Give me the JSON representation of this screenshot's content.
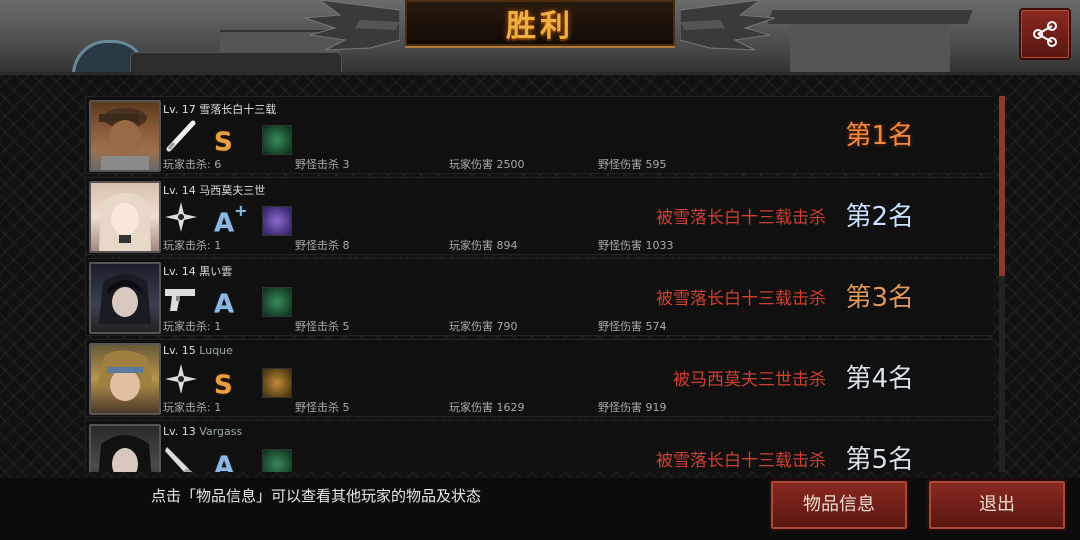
{
  "header": {
    "title": "胜利",
    "share_icon": "share-icon"
  },
  "players": [
    {
      "level": "Lv. 17",
      "name": "雪落长白十三载",
      "weapon": "bat-icon",
      "grade": "S",
      "grade_plus": "",
      "player_kills_label": "玩家击杀: 6",
      "monster_kills_label": "野怪击杀 3",
      "player_damage_label": "玩家伤害 2500",
      "monster_damage_label": "野怪伤害 595",
      "killed_by": "",
      "rank": "第1名"
    },
    {
      "level": "Lv. 14",
      "name": "马西莫夫三世",
      "weapon": "shuriken-icon",
      "grade": "A",
      "grade_plus": "+",
      "player_kills_label": "玩家击杀: 1",
      "monster_kills_label": "野怪击杀 8",
      "player_damage_label": "玩家伤害 894",
      "monster_damage_label": "野怪伤害 1033",
      "killed_by": "被雪落长白十三载击杀",
      "rank": "第2名"
    },
    {
      "level": "Lv. 14",
      "name": "黒い雲",
      "weapon": "pistol-icon",
      "grade": "A",
      "grade_plus": "",
      "player_kills_label": "玩家击杀: 1",
      "monster_kills_label": "野怪击杀 5",
      "player_damage_label": "玩家伤害 790",
      "monster_damage_label": "野怪伤害 574",
      "killed_by": "被雪落长白十三载击杀",
      "rank": "第3名"
    },
    {
      "level": "Lv. 15",
      "name": "Luque",
      "weapon": "shuriken-icon",
      "grade": "S",
      "grade_plus": "",
      "player_kills_label": "玩家击杀: 1",
      "monster_kills_label": "野怪击杀 5",
      "player_damage_label": "玩家伤害 1629",
      "monster_damage_label": "野怪伤害 919",
      "killed_by": "被马西莫夫三世击杀",
      "rank": "第4名"
    },
    {
      "level": "Lv. 13",
      "name": "Vargass",
      "weapon": "knife-icon",
      "grade": "A",
      "grade_plus": "",
      "player_kills_label": "",
      "monster_kills_label": "",
      "player_damage_label": "",
      "monster_damage_label": "",
      "killed_by": "被雪落长白十三载击杀",
      "rank": "第5名"
    }
  ],
  "footer": {
    "hint": "点击「物品信息」可以查看其他玩家的物品及状态",
    "info_button": "物品信息",
    "exit_button": "退出"
  },
  "colors": {
    "title": "#f0b040",
    "killed_text": "#d04030",
    "rank_first": "#f08a40",
    "button_bg": "#7a2018",
    "grade_s": "#e9a040",
    "grade_a": "#8fb8e0"
  }
}
